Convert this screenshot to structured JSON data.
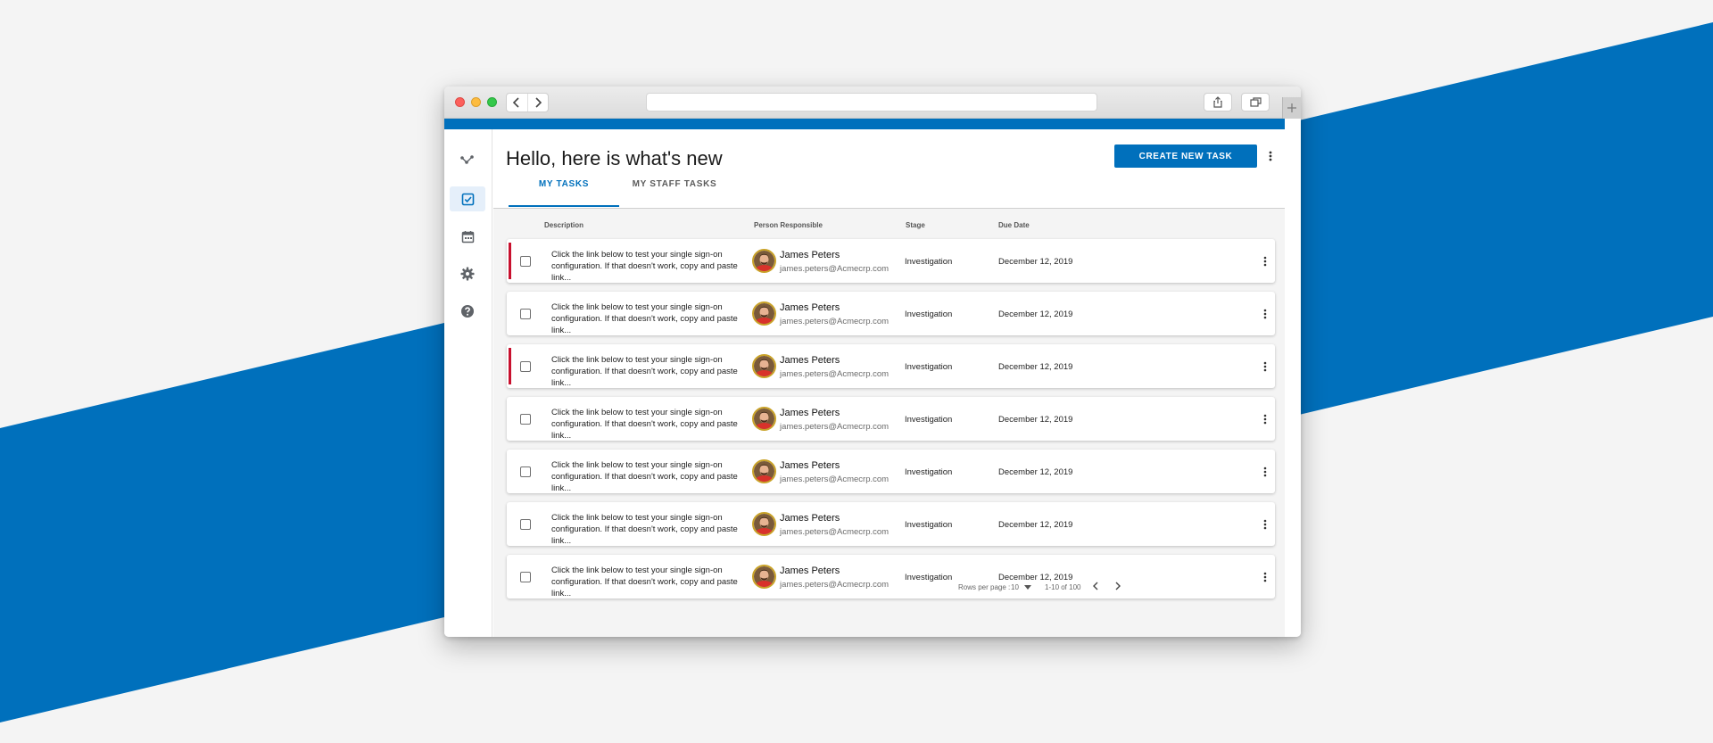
{
  "colors": {
    "accent": "#0070bc",
    "priority": "#c8102e",
    "background": "#f4f4f4"
  },
  "header": {
    "title": "Hello, here is what's new",
    "create_button": "CREATE NEW TASK",
    "more_icon": "more-vertical-icon"
  },
  "sidebar": {
    "items": [
      {
        "icon": "workflow-icon",
        "active": false
      },
      {
        "icon": "task-check-icon",
        "active": true
      },
      {
        "icon": "calendar-icon",
        "active": false
      },
      {
        "icon": "gear-icon",
        "active": false
      },
      {
        "icon": "help-icon",
        "active": false
      }
    ]
  },
  "tabs": [
    {
      "label": "MY TASKS",
      "active": true
    },
    {
      "label": "MY STAFF TASKS",
      "active": false
    }
  ],
  "table": {
    "columns": [
      "Description",
      "Person Responsible",
      "Stage",
      "Due Date"
    ],
    "rows": [
      {
        "priority": true,
        "desc1": "Click the link below to test your single sign-on",
        "desc2": "configuration. If that doesn't work, copy and paste link...",
        "name": "James Peters",
        "email": "james.peters@Acmecrp.com",
        "stage": "Investigation",
        "due": "December 12, 2019"
      },
      {
        "priority": false,
        "desc1": "Click the link below to test your single sign-on",
        "desc2": "configuration. If that doesn't work, copy and paste link...",
        "name": "James Peters",
        "email": "james.peters@Acmecrp.com",
        "stage": "Investigation",
        "due": "December 12, 2019"
      },
      {
        "priority": true,
        "desc1": "Click the link below to test your single sign-on",
        "desc2": "configuration. If that doesn't work, copy and paste link...",
        "name": "James Peters",
        "email": "james.peters@Acmecrp.com",
        "stage": "Investigation",
        "due": "December 12, 2019"
      },
      {
        "priority": false,
        "desc1": "Click the link below to test your single sign-on",
        "desc2": "configuration. If that doesn't work, copy and paste link...",
        "name": "James Peters",
        "email": "james.peters@Acmecrp.com",
        "stage": "Investigation",
        "due": "December 12, 2019"
      },
      {
        "priority": false,
        "desc1": "Click the link below to test your single sign-on",
        "desc2": "configuration. If that doesn't work, copy and paste link...",
        "name": "James Peters",
        "email": "james.peters@Acmecrp.com",
        "stage": "Investigation",
        "due": "December 12, 2019"
      },
      {
        "priority": false,
        "desc1": "Click the link below to test your single sign-on",
        "desc2": "configuration. If that doesn't work, copy and paste link...",
        "name": "James Peters",
        "email": "james.peters@Acmecrp.com",
        "stage": "Investigation",
        "due": "December 12, 2019"
      },
      {
        "priority": false,
        "desc1": "Click the link below to test your single sign-on",
        "desc2": "configuration. If that doesn't work, copy and paste link...",
        "name": "James Peters",
        "email": "james.peters@Acmecrp.com",
        "stage": "Investigation",
        "due": "December 12, 2019"
      }
    ]
  },
  "pagination": {
    "rows_label": "Rows per page :",
    "rows_value": "10",
    "range": "1-10 of 100"
  }
}
